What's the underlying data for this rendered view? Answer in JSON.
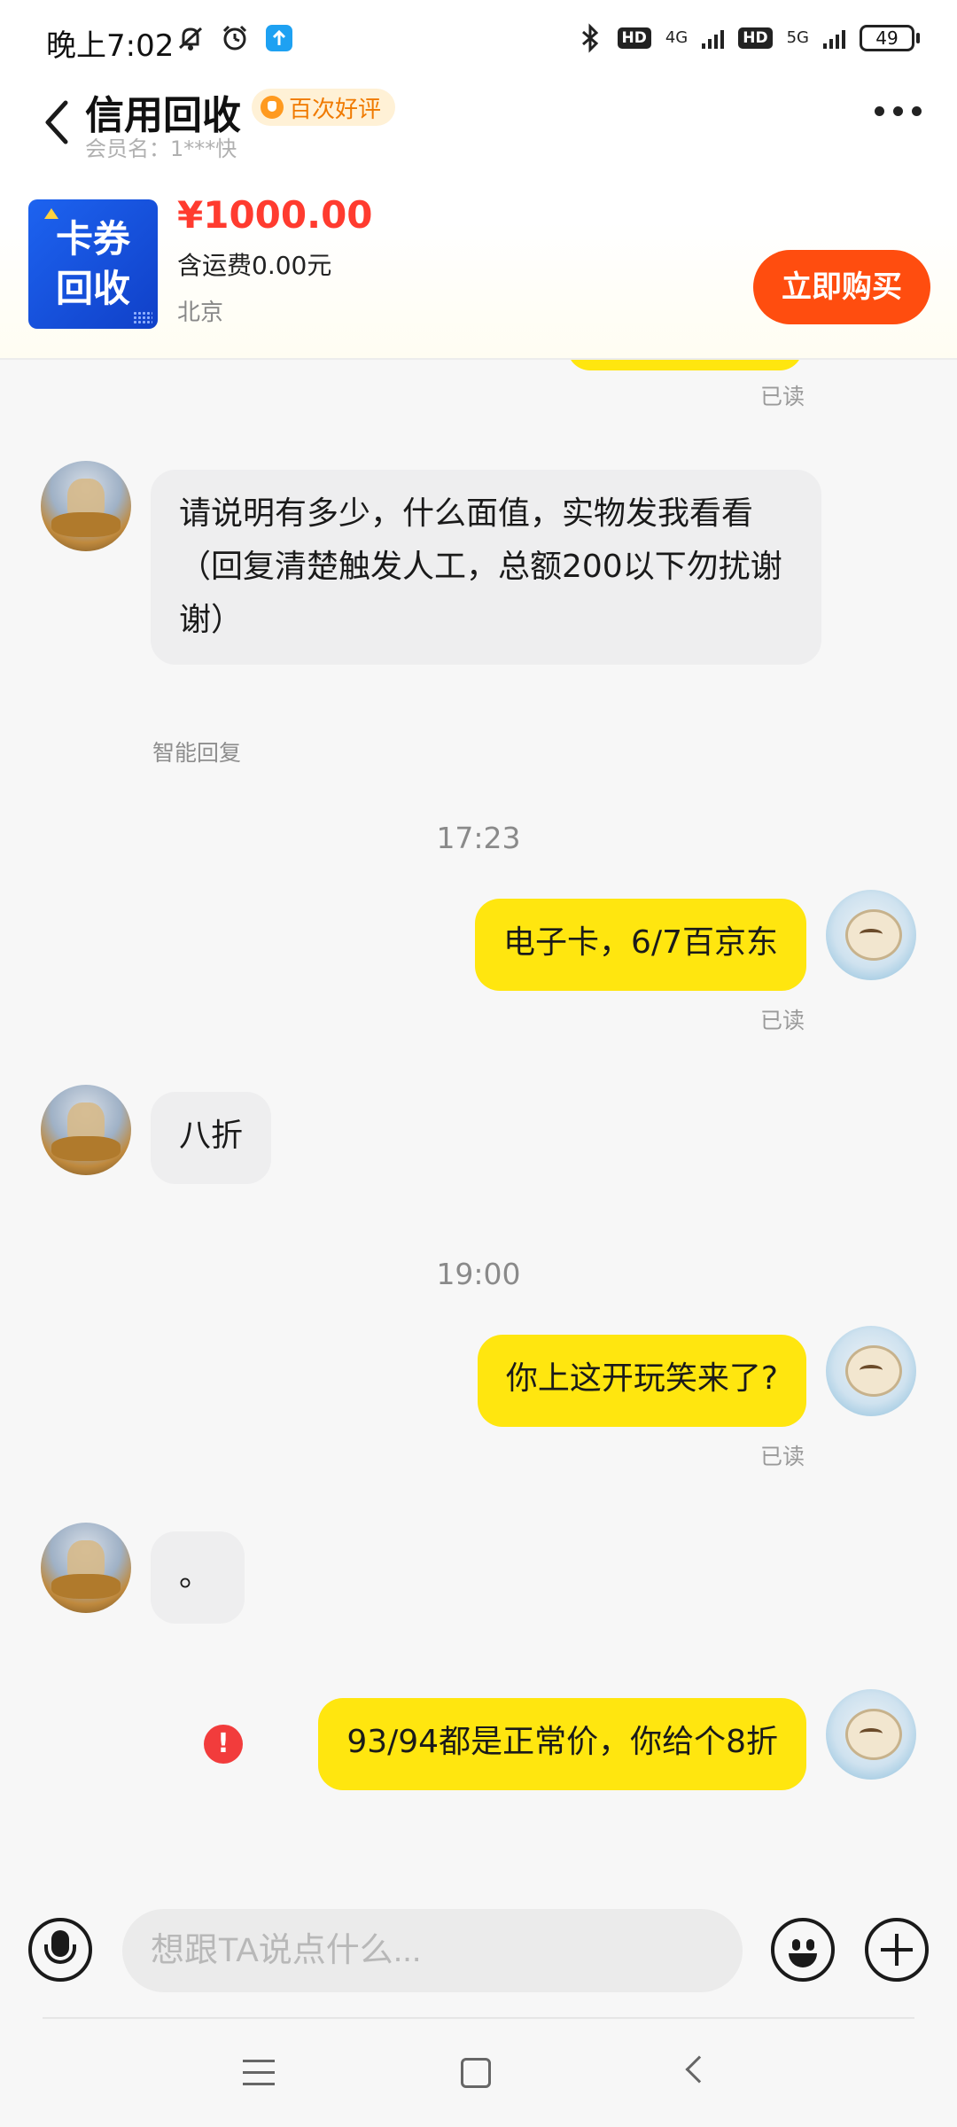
{
  "status_bar": {
    "time": "晚上7:02",
    "network1": "4G",
    "network2": "5G",
    "hd1": "HD",
    "hd2": "HD",
    "battery": "49"
  },
  "header": {
    "title": "信用回收",
    "badge": "百次好评",
    "member": "会员名：1***快"
  },
  "product": {
    "thumb_line1": "卡券",
    "thumb_line2": "回收",
    "price": "¥1000.00",
    "shipping": "含运费0.00元",
    "location": "北京",
    "buy_label": "立即购买"
  },
  "chat": {
    "read_label": "已读",
    "messages": [
      {
        "side": "in",
        "text": "请说明有多少，什么面值，实物发我看看\n（回复清楚触发人工，总额200以下勿扰谢谢）",
        "label": "智能回复"
      },
      {
        "type": "time",
        "text": "17:23"
      },
      {
        "side": "out",
        "text": "电子卡，6/7百京东"
      },
      {
        "side": "in",
        "text": "八折"
      },
      {
        "type": "time",
        "text": "19:00"
      },
      {
        "side": "out",
        "text": "你上这开玩笑来了?"
      },
      {
        "side": "in",
        "text": "。"
      },
      {
        "side": "out",
        "text": "93/94都是正常价，你给个8折",
        "failed": true
      }
    ]
  },
  "input": {
    "placeholder": "想跟TA说点什么..."
  },
  "colors": {
    "accent_yellow": "#ffe60f",
    "buy_button": "#ff4d0f",
    "price_red": "#ff3b2f",
    "error_red": "#f23c3c"
  },
  "icons": [
    "back-arrow-icon",
    "badge-icon",
    "more-icon",
    "mic-icon",
    "emoji-icon",
    "plus-icon",
    "error-icon",
    "nav-menu-icon",
    "nav-home-icon",
    "nav-back-icon"
  ]
}
